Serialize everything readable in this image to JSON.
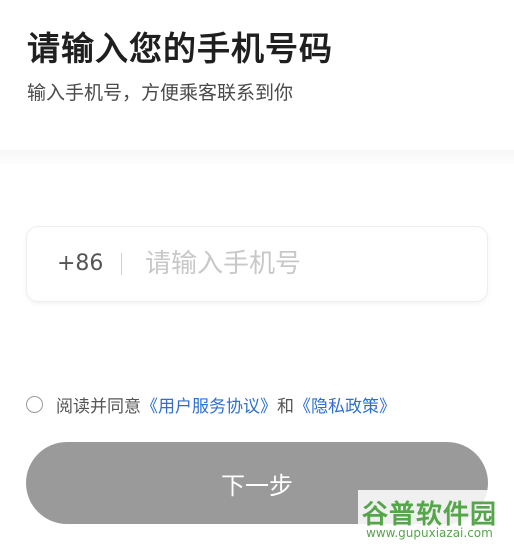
{
  "header": {
    "title": "请输入您的手机号码",
    "subtitle": "输入手机号，方便乘客联系到你"
  },
  "phone_field": {
    "country_code": "+86",
    "placeholder": "请输入手机号",
    "value": ""
  },
  "agreement": {
    "checked": false,
    "prefix": "阅读并同意",
    "terms_link": "《用户服务协议》",
    "connector": "和",
    "privacy_link": "《隐私政策》"
  },
  "next_button": {
    "label": "下一步",
    "enabled": false
  },
  "watermark": {
    "logo_text": "谷普软件园",
    "url": "www.gupuxiazai.com"
  },
  "colors": {
    "link": "#2e6fd0",
    "button_disabled": "#9a9a9a",
    "placeholder": "#c8c8c8",
    "watermark": "#55a64a"
  }
}
